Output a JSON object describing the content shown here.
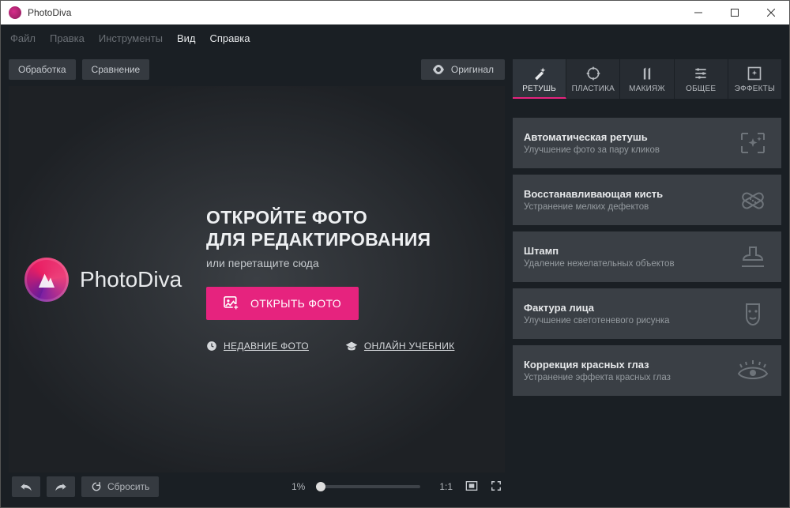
{
  "app": {
    "title": "PhotoDiva",
    "brand": "PhotoDiva"
  },
  "menus": {
    "file": "Файл",
    "edit": "Правка",
    "tools": "Инструменты",
    "view": "Вид",
    "help": "Справка"
  },
  "view_toolbar": {
    "processing": "Обработка",
    "compare": "Сравнение",
    "original": "Оригинал"
  },
  "welcome": {
    "line1": "ОТКРОЙТЕ ФОТО",
    "line2": "ДЛЯ РЕДАКТИРОВАНИЯ",
    "sub": "или перетащите сюда",
    "open_button": "ОТКРЫТЬ ФОТО",
    "recent_label": "НЕДАВНИЕ ФОТО",
    "tutorial_label": "ОНЛАЙН УЧЕБНИК"
  },
  "bottom": {
    "reset": "Сбросить",
    "zoom_pct": "1%",
    "ratio": "1:1"
  },
  "tabs": {
    "retouch": "РЕТУШЬ",
    "plastic": "ПЛАСТИКА",
    "makeup": "МАКИЯЖ",
    "general": "ОБЩЕЕ",
    "effects": "ЭФФЕКТЫ"
  },
  "tools": [
    {
      "title": "Автоматическая ретушь",
      "desc": "Улучшение фото за пару кликов"
    },
    {
      "title": "Восстанавливающая кисть",
      "desc": "Устранение мелких дефектов"
    },
    {
      "title": "Штамп",
      "desc": "Удаление нежелательных объектов"
    },
    {
      "title": "Фактура лица",
      "desc": "Улучшение светотеневого рисунка"
    },
    {
      "title": "Коррекция красных глаз",
      "desc": "Устранение эффекта красных глаз"
    }
  ]
}
